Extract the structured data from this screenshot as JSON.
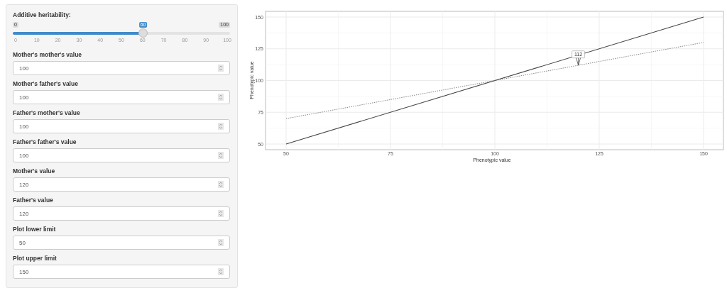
{
  "slider": {
    "label": "Additive heritability:",
    "min_label": "0",
    "max_label": "100",
    "value_label": "60",
    "level": 0.6,
    "tick_labels": [
      "0",
      "10",
      "20",
      "30",
      "40",
      "50",
      "60",
      "70",
      "80",
      "90",
      "100"
    ]
  },
  "inputs": [
    {
      "label": "Mother's mother's value",
      "value": "100"
    },
    {
      "label": "Mother's father's value",
      "value": "100"
    },
    {
      "label": "Father's mother's value",
      "value": "100"
    },
    {
      "label": "Father's father's value",
      "value": "100"
    },
    {
      "label": "Mother's value",
      "value": "120"
    },
    {
      "label": "Father's value",
      "value": "120"
    },
    {
      "label": "Plot lower limit",
      "value": "50"
    },
    {
      "label": "Plot upper limit",
      "value": "150"
    }
  ],
  "plot": {
    "chart_data": {
      "type": "line",
      "xlabel": "Phenotypic value",
      "ylabel": "Phenotypic value",
      "x": [
        50,
        150
      ],
      "grid": true,
      "series": [
        {
          "color": "#444444",
          "line_style": "solid",
          "values": [
            50,
            150
          ]
        },
        {
          "color": "#777777",
          "line_style": "dotted",
          "values": [
            70,
            130
          ]
        }
      ],
      "xlim": [
        50,
        150
      ],
      "ylim": [
        50,
        150
      ],
      "xticks": [
        50,
        75,
        100,
        125,
        150
      ],
      "yticks": [
        50,
        75,
        100,
        125,
        150
      ],
      "annotations": [
        {
          "x": 120,
          "y": 112,
          "text": "112"
        }
      ]
    }
  }
}
